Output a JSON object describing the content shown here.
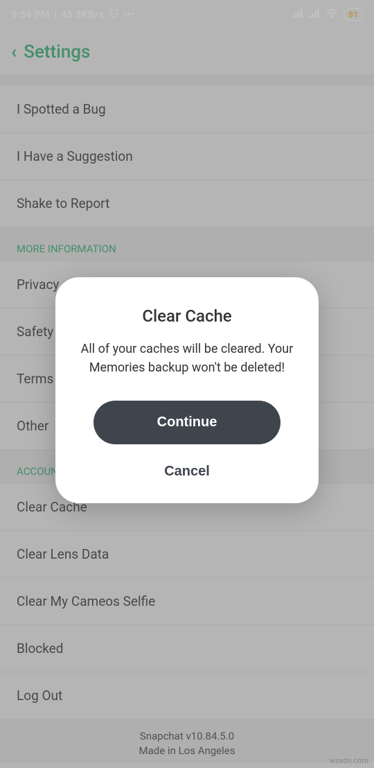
{
  "status": {
    "time": "9:54 PM",
    "speed": "45.3KB/s",
    "battery": "81"
  },
  "header": {
    "title": "Settings"
  },
  "items": [
    "I Spotted a Bug",
    "I Have a Suggestion",
    "Shake to Report"
  ],
  "section1": "MORE INFORMATION",
  "items2": [
    "Privacy",
    "Safety",
    "Terms",
    "Other"
  ],
  "section2": "ACCOUNT ACTIONS",
  "items3": [
    "Clear Cache",
    "Clear Lens Data",
    "Clear My Cameos Selfie",
    "Blocked",
    "Log Out"
  ],
  "footer": {
    "version": "Snapchat v10.84.5.0",
    "made": "Made in Los Angeles"
  },
  "dialog": {
    "title": "Clear Cache",
    "body": "All of your caches will be cleared. Your Memories backup won't be deleted!",
    "continue": "Continue",
    "cancel": "Cancel"
  },
  "watermark": "wsxdn.com"
}
